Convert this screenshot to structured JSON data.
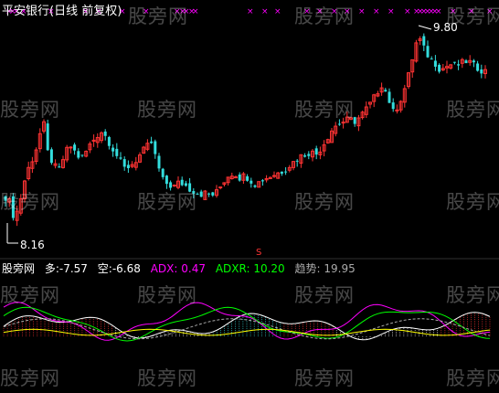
{
  "title": "平安银行(日线 前复权)",
  "watermark": "股旁网",
  "price_chart": {
    "high_label": "9.80",
    "low_label": "8.16"
  },
  "indicator": {
    "name": "股旁网",
    "duo_label": "多:",
    "duo_value": "-7.57",
    "kong_label": "空:",
    "kong_value": "-6.68",
    "adx_label": "ADX:",
    "adx_value": "0.47",
    "adxr_label": "ADXR:",
    "adxr_value": "10.20",
    "trend_label": "趋势:",
    "trend_value": "19.95"
  },
  "colors": {
    "up": "#ff3333",
    "down": "#33dddd",
    "magenta": "#ff00ff",
    "green": "#00ff00",
    "yellow": "#ffff00",
    "white": "#ffffff",
    "gray": "#aaaaaa"
  },
  "chart_data": [
    {
      "type": "candlestick",
      "title": "平安银行(日线 前复权)",
      "annotations": {
        "high": 9.8,
        "low": 8.16
      }
    },
    {
      "type": "line",
      "series_labels": [
        "多",
        "空",
        "ADX",
        "ADXR",
        "趋势"
      ],
      "latest_values": [
        -7.57,
        -6.68,
        0.47,
        10.2,
        19.95
      ]
    }
  ]
}
